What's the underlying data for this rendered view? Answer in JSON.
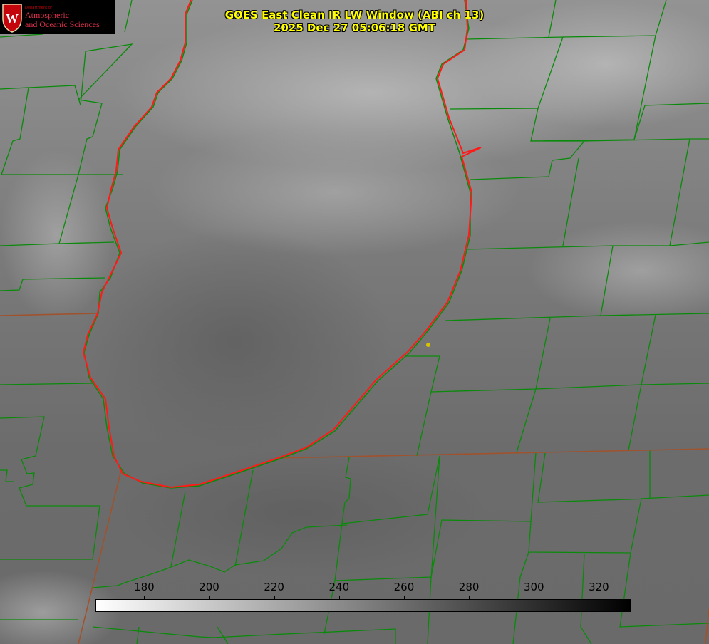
{
  "logo": {
    "dept_text": "Department of",
    "line1": "Atmospheric",
    "line2": "and Oceanic Sciences",
    "seal_letter": "W"
  },
  "title": {
    "line1": "GOES East Clean IR LW Window (ABI ch 13)",
    "line2": "2025 Dec 27 05:06:18 GMT"
  },
  "colorbar": {
    "ticks": [
      "180",
      "200",
      "220",
      "240",
      "260",
      "280",
      "300",
      "320"
    ],
    "min_value": 165,
    "max_value": 330
  },
  "colors": {
    "county_lines": "#0a8a0a",
    "state_lines": "#a0522d",
    "lake_outline": "#ff1a1a",
    "title_text": "#ffff00",
    "marker": "#d9c200"
  }
}
